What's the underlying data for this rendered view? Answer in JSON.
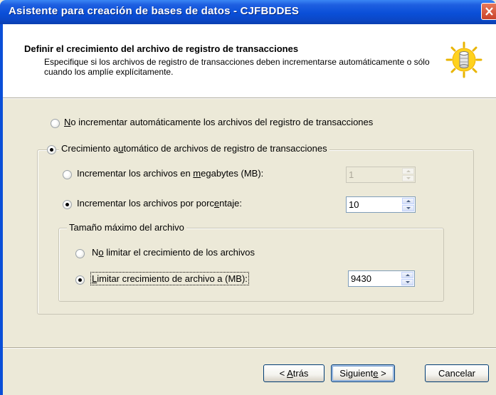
{
  "window": {
    "title": "Asistente para creación de bases de datos - CJFBDDES",
    "close_label": "×"
  },
  "header": {
    "title": "Definir el crecimiento del archivo de registro de transacciones",
    "description": "Especifique si los archivos de registro de transacciones deben incrementarse automáticamente o sólo cuando los amplíe explícitamente."
  },
  "options": {
    "no_auto_growth": {
      "label_prefix": "",
      "label_u": "N",
      "label_rest": "o incrementar automáticamente los archivos del registro de transacciones",
      "checked": false
    },
    "auto_growth": {
      "label_prefix": "Crecimiento a",
      "label_u": "u",
      "label_rest": "tomático de archivos de registro de transacciones",
      "checked": true
    },
    "by_megabytes": {
      "label_prefix": "Incrementar los archivos en ",
      "label_u": "m",
      "label_rest": "egabytes (MB):",
      "checked": false,
      "value": "1",
      "enabled": false
    },
    "by_percent": {
      "label_prefix": "Incrementar los archivos por porc",
      "label_u": "e",
      "label_rest": "ntaje:",
      "checked": true,
      "value": "10",
      "enabled": true
    }
  },
  "max_size": {
    "group_title": "Tamaño máximo del archivo",
    "unlimited": {
      "label_prefix": "N",
      "label_u": "o",
      "label_rest": " limitar el crecimiento de los archivos",
      "checked": false
    },
    "limit": {
      "label_prefix": "",
      "label_u": "L",
      "label_rest": "imitar crecimiento de archivo a (MB):",
      "checked": true,
      "value": "9430"
    }
  },
  "buttons": {
    "back": {
      "prefix": "< ",
      "u": "A",
      "rest": "trás"
    },
    "next": {
      "prefix": "Siguient",
      "u": "e",
      "rest": " >"
    },
    "cancel": "Cancelar"
  },
  "colors": {
    "title_bar": "#0A4FD8",
    "close_button": "#C9432A",
    "dialog_bg": "#ECE9D8"
  },
  "icons": {
    "header_icon": "database-cylinder-icon",
    "close_icon": "close-icon"
  }
}
